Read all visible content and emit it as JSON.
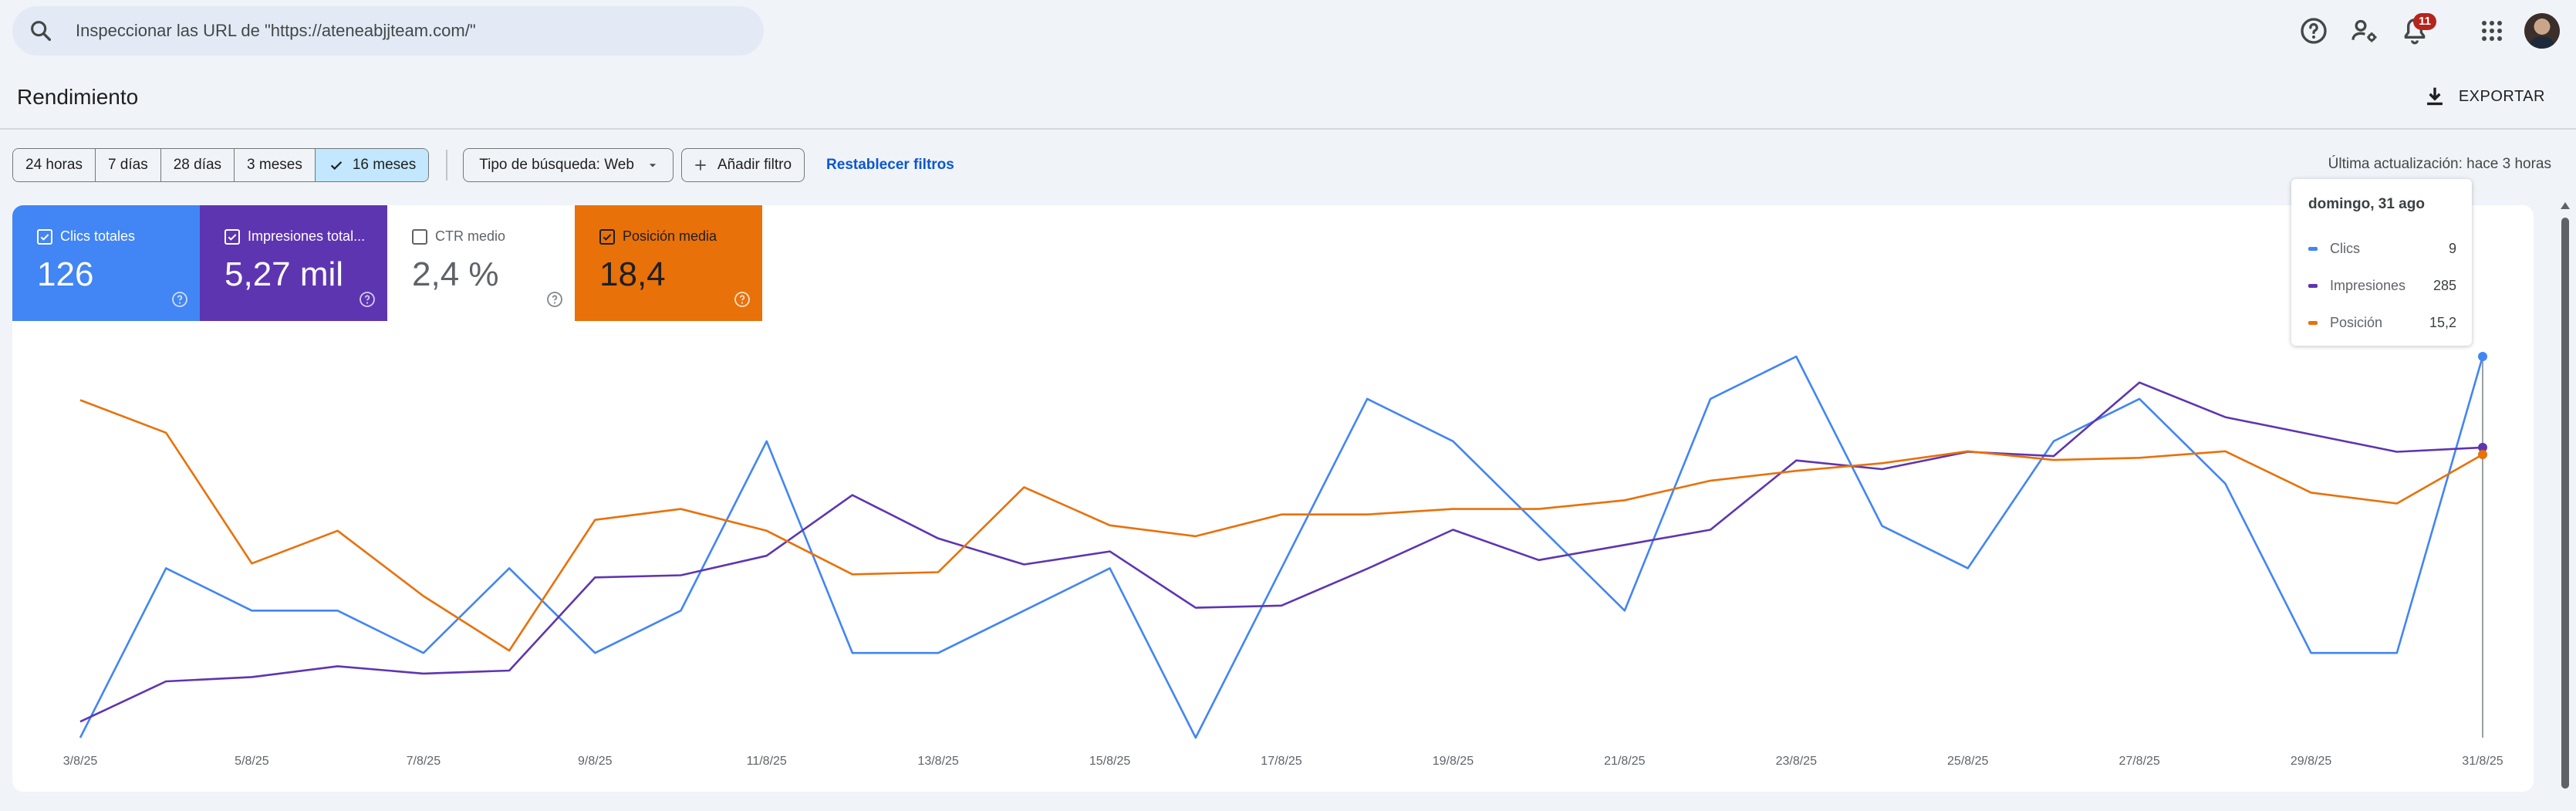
{
  "search": {
    "placeholder": "Inspeccionar las URL de \"https://ateneabjjteam.com/\""
  },
  "notifications": {
    "count": "11"
  },
  "header": {
    "title": "Rendimiento",
    "export_label": "EXPORTAR"
  },
  "filters": {
    "ranges": [
      "24 horas",
      "7 días",
      "28 días",
      "3 meses",
      "16 meses"
    ],
    "active_range": "16 meses",
    "search_type": "Tipo de búsqueda: Web",
    "add_filter": "Añadir filtro",
    "reset": "Restablecer filtros"
  },
  "last_update": "Última actualización: hace 3 horas",
  "metrics": [
    {
      "label": "Clics totales",
      "value": "126",
      "checked": true,
      "color": "#4285f4"
    },
    {
      "label": "Impresiones total...",
      "value": "5,27 mil",
      "checked": true,
      "color": "#5e35b1"
    },
    {
      "label": "CTR medio",
      "value": "2,4 %",
      "checked": false,
      "color": "#ffffff"
    },
    {
      "label": "Posición media",
      "value": "18,4",
      "checked": true,
      "color": "#e8710a"
    }
  ],
  "tooltip": {
    "date": "domingo, 31 ago",
    "rows": [
      {
        "label": "Clics",
        "value": "9",
        "color": "#4285f4"
      },
      {
        "label": "Impresiones",
        "value": "285",
        "color": "#5e35b1"
      },
      {
        "label": "Posición",
        "value": "15,2",
        "color": "#e8710a"
      }
    ]
  },
  "chart_data": {
    "type": "line",
    "x": [
      "3/8/25",
      "4/8/25",
      "5/8/25",
      "6/8/25",
      "7/8/25",
      "8/8/25",
      "9/8/25",
      "10/8/25",
      "11/8/25",
      "12/8/25",
      "13/8/25",
      "14/8/25",
      "15/8/25",
      "16/8/25",
      "17/8/25",
      "18/8/25",
      "19/8/25",
      "20/8/25",
      "21/8/25",
      "22/8/25",
      "23/8/25",
      "24/8/25",
      "25/8/25",
      "26/8/25",
      "27/8/25",
      "28/8/25",
      "29/8/25",
      "30/8/25",
      "31/8/25"
    ],
    "tick_labels": [
      "3/8/25",
      "5/8/25",
      "7/8/25",
      "9/8/25",
      "11/8/25",
      "13/8/25",
      "15/8/25",
      "17/8/25",
      "19/8/25",
      "21/8/25",
      "23/8/25",
      "25/8/25",
      "27/8/25",
      "29/8/25",
      "31/8/25"
    ],
    "series": [
      {
        "name": "Clics",
        "color": "#4285f4",
        "values": [
          0,
          4,
          3,
          3,
          2,
          4,
          2,
          3,
          7,
          2,
          2,
          3,
          4,
          0,
          4,
          8,
          7,
          5,
          3,
          8,
          9,
          5,
          4,
          7,
          8,
          6,
          2,
          2,
          9
        ]
      },
      {
        "name": "Impresiones",
        "color": "#5e35b1",
        "values": [
          37,
          130,
          140,
          165,
          148,
          155,
          370,
          375,
          420,
          560,
          460,
          400,
          430,
          300,
          305,
          390,
          480,
          410,
          445,
          480,
          640,
          620,
          660,
          650,
          820,
          740,
          700,
          660,
          670
        ]
      },
      {
        "name": "Posición",
        "color": "#e8710a",
        "values": [
          31,
          28,
          16,
          19,
          13,
          8,
          20,
          21,
          19,
          15,
          15.2,
          23,
          19.5,
          18.5,
          20.5,
          20.5,
          21,
          21,
          21.8,
          23.6,
          24.5,
          25.2,
          26.3,
          25.5,
          25.7,
          26.3,
          22.5,
          21.5,
          26
        ]
      }
    ],
    "ylim_clics": [
      0,
      9
    ],
    "ylim_impresiones": [
      0,
      880
    ],
    "ylim_posicion": [
      0,
      35
    ],
    "highlight_x": "31/8/25",
    "grid": false,
    "legend": "none"
  }
}
